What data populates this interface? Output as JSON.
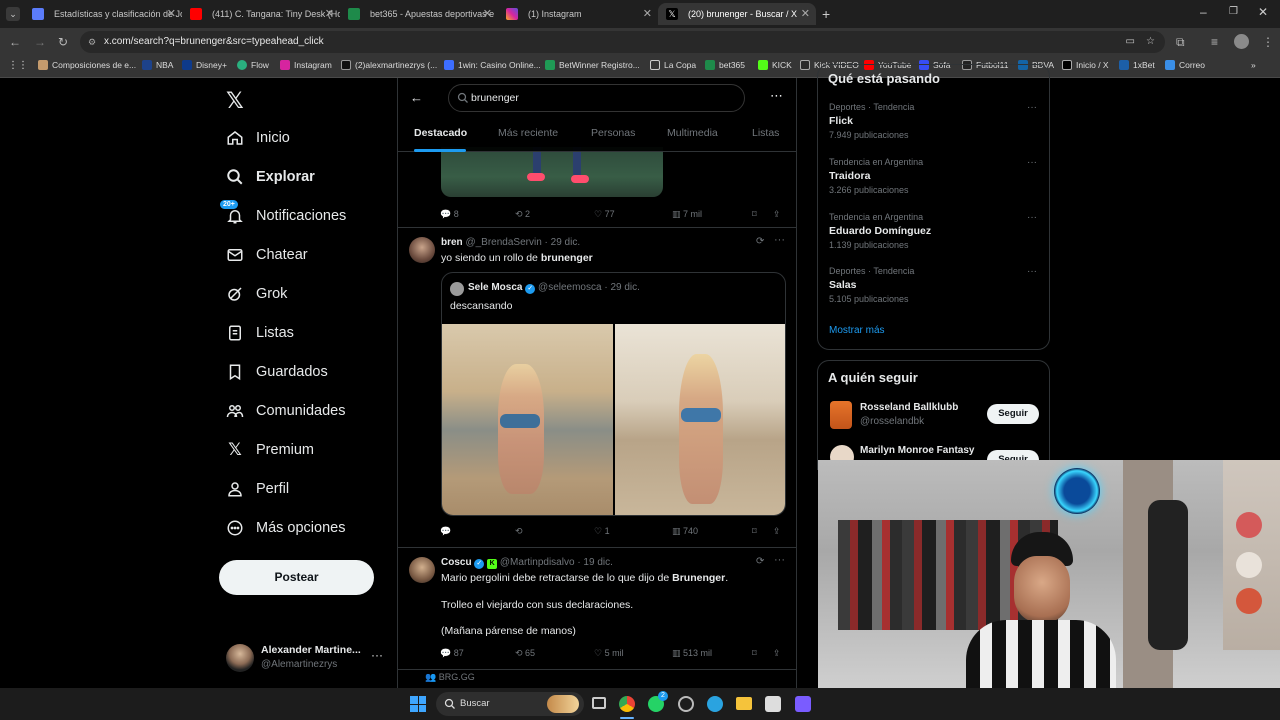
{
  "browser": {
    "tabs": [
      {
        "title": "Estadísticas y clasificación de Jo",
        "color": "#5b7cfa"
      },
      {
        "title": "(411) C. Tangana: Tiny Desk (Ho",
        "color": "#ff0000"
      },
      {
        "title": "bet365 - Apuestas deportivas e",
        "color": "#1e8a4a"
      },
      {
        "title": "(1) Instagram",
        "color": "#d6249f"
      },
      {
        "title": "(20) brunenger - Buscar / X",
        "color": "#ffffff"
      }
    ],
    "url": "x.com/search?q=brunenger&src=typeahead_click",
    "bookmarks": [
      "Composiciones de e...",
      "NBA",
      "Disney+",
      "Flow",
      "Instagram",
      "(2)alexmartinezrys (...",
      "1win: Casino Online...",
      "BetWinner Registro...",
      "La Copa",
      "bet365",
      "KICK",
      "Kick VIDEO",
      "YouTube",
      "Sofa",
      "Futbol11",
      "BBVA",
      "Inicio / X",
      "1xBet",
      "Correo"
    ]
  },
  "nav": {
    "items": [
      "Inicio",
      "Explorar",
      "Notificaciones",
      "Chatear",
      "Grok",
      "Listas",
      "Guardados",
      "Comunidades",
      "Premium",
      "Perfil",
      "Más opciones"
    ],
    "notif_badge": "20+",
    "post_button": "Postear",
    "account_name": "Alexander Martine...",
    "account_handle": "@Alemartinezrys"
  },
  "search": {
    "query": "brunenger",
    "tabs": [
      "Destacado",
      "Más reciente",
      "Personas",
      "Multimedia",
      "Listas"
    ]
  },
  "tweets": [
    {
      "stats": {
        "replies": "8",
        "retweets": "2",
        "likes": "77",
        "views": "7 mil"
      }
    },
    {
      "name": "bren",
      "handle": "@_BrendaServin",
      "date": "· 29 dic.",
      "text_pre": "yo siendo un rollo de ",
      "text_bold": "brunenger",
      "quote": {
        "name": "Sele Mosca",
        "handle": "@seleemosca",
        "date": "· 29 dic.",
        "text": "descansando"
      },
      "stats": {
        "replies": "",
        "retweets": "",
        "likes": "1",
        "views": "740"
      }
    },
    {
      "name": "Coscu",
      "handle": "@Martinpdisalvo",
      "date": "· 19 dic.",
      "line1_pre": "Mario pergolini debe retractarse de lo que dijo de ",
      "line1_bold": "Brunenger",
      "line1_post": ".",
      "line2": "Trolleo el viejardo con sus declaraciones.",
      "line3": "(Mañana párense de manos)",
      "stats": {
        "replies": "87",
        "retweets": "65",
        "likes": "5 mil",
        "views": "513 mil"
      }
    }
  ],
  "bottom_label": "BRG.GG",
  "trends": {
    "header": "Qué está pasando",
    "items": [
      {
        "meta": "Deportes · Tendencia",
        "name": "Flick",
        "count": "7.949 publicaciones"
      },
      {
        "meta": "Tendencia en Argentina",
        "name": "Traidora",
        "count": "3.266 publicaciones"
      },
      {
        "meta": "Tendencia en Argentina",
        "name": "Eduardo Domínguez",
        "count": "1.139 publicaciones"
      },
      {
        "meta": "Deportes · Tendencia",
        "name": "Salas",
        "count": "5.105 publicaciones"
      }
    ],
    "show_more": "Mostrar más"
  },
  "follow": {
    "header": "A quién seguir",
    "items": [
      {
        "name": "Rosseland Ballklubb",
        "handle": "@rosselandbk",
        "button": "Seguir"
      },
      {
        "name": "Marilyn Monroe Fantasy",
        "handle": "",
        "button": "Seguir"
      }
    ]
  },
  "taskbar": {
    "search_placeholder": "Buscar",
    "badge": "2"
  },
  "colors": {
    "accent": "#1d9bf0",
    "bg": "#000000",
    "border": "#2f3336",
    "muted": "#71767b"
  }
}
